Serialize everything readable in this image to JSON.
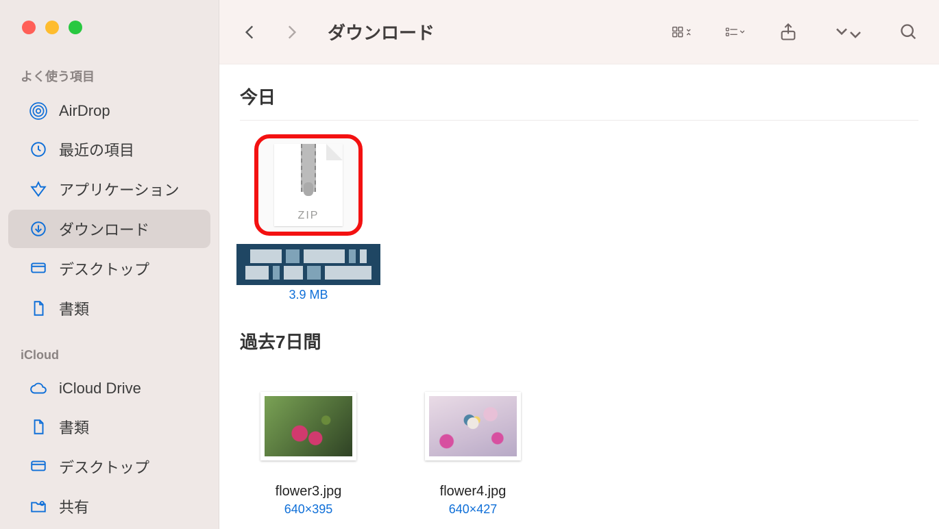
{
  "toolbar": {
    "title": "ダウンロード"
  },
  "sidebar": {
    "sections": [
      {
        "title": "よく使う項目",
        "items": [
          {
            "icon": "airdrop-icon",
            "label": "AirDrop"
          },
          {
            "icon": "clock-icon",
            "label": "最近の項目"
          },
          {
            "icon": "applications-icon",
            "label": "アプリケーション"
          },
          {
            "icon": "download-icon",
            "label": "ダウンロード",
            "active": true
          },
          {
            "icon": "desktop-icon",
            "label": "デスクトップ"
          },
          {
            "icon": "document-icon",
            "label": "書類"
          }
        ]
      },
      {
        "title": "iCloud",
        "items": [
          {
            "icon": "cloud-icon",
            "label": "iCloud Drive"
          },
          {
            "icon": "document-icon",
            "label": "書類"
          },
          {
            "icon": "desktop-icon",
            "label": "デスクトップ"
          },
          {
            "icon": "shared-folder-icon",
            "label": "共有"
          }
        ]
      }
    ]
  },
  "content": {
    "groups": [
      {
        "header": "今日",
        "files": [
          {
            "kind": "zip",
            "zip_label": "ZIP",
            "name_redacted": true,
            "meta": "3.9 MB",
            "highlight": true
          }
        ]
      },
      {
        "header": "過去7日間",
        "files": [
          {
            "kind": "image1",
            "name": "flower3.jpg",
            "meta": "640×395"
          },
          {
            "kind": "image2",
            "name": "flower4.jpg",
            "meta": "640×427"
          }
        ]
      }
    ]
  }
}
